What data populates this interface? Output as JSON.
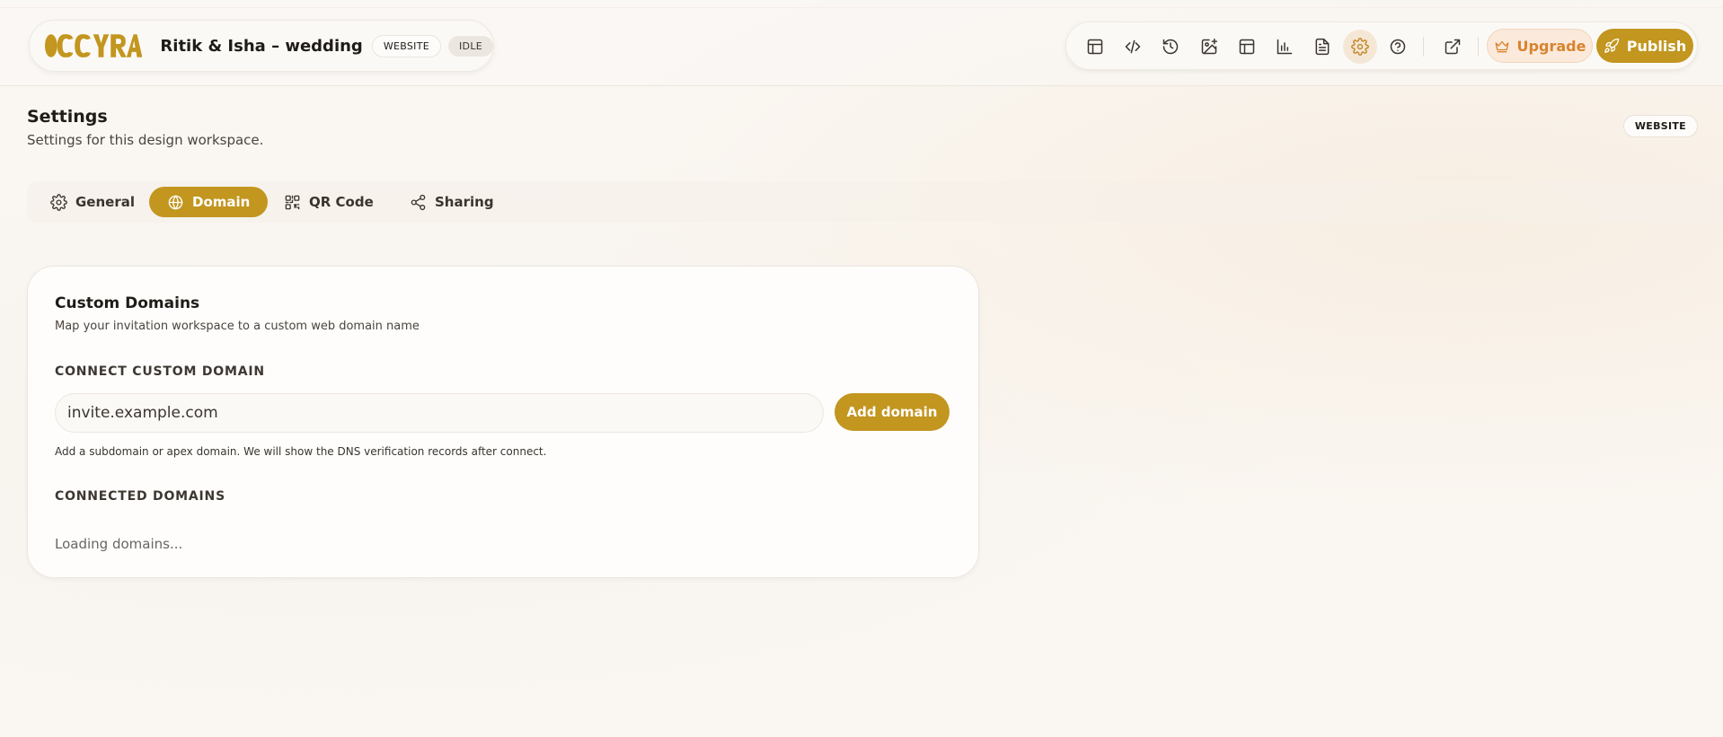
{
  "header": {
    "logo_text": "OCCYRA",
    "project_title": "Ritik & Isha – wedding",
    "type_badge": "WEBSITE",
    "status_badge": "IDLE",
    "toolbar_icons": [
      "layout-icon",
      "code-icon",
      "history-icon",
      "image-add-icon",
      "template-icon",
      "analytics-icon",
      "document-icon",
      "gear-icon",
      "help-icon",
      "external-link-icon"
    ],
    "active_tool": "gear-icon",
    "upgrade_label": "Upgrade",
    "publish_label": "Publish"
  },
  "page": {
    "title": "Settings",
    "subtitle": "Settings for this design workspace.",
    "workspace_tag": "WEBSITE"
  },
  "tabs": [
    {
      "label": "General",
      "icon": "gear-icon",
      "active": false
    },
    {
      "label": "Domain",
      "icon": "globe-icon",
      "active": true
    },
    {
      "label": "QR Code",
      "icon": "qr-code-icon",
      "active": false
    },
    {
      "label": "Sharing",
      "icon": "share-icon",
      "active": false
    }
  ],
  "custom_domains": {
    "title": "Custom Domains",
    "description": "Map your invitation workspace to a custom web domain name",
    "connect_label": "CONNECT CUSTOM DOMAIN",
    "input_placeholder": "invite.example.com",
    "input_value": "",
    "add_button_label": "Add domain",
    "hint": "Add a subdomain or apex domain. We will show the DNS verification records after connect.",
    "connected_label": "CONNECTED DOMAINS",
    "loading_text": "Loading domains..."
  },
  "colors": {
    "accent": "#c2961f",
    "upgrade": "#d9832e",
    "background": "#faf7f3"
  }
}
